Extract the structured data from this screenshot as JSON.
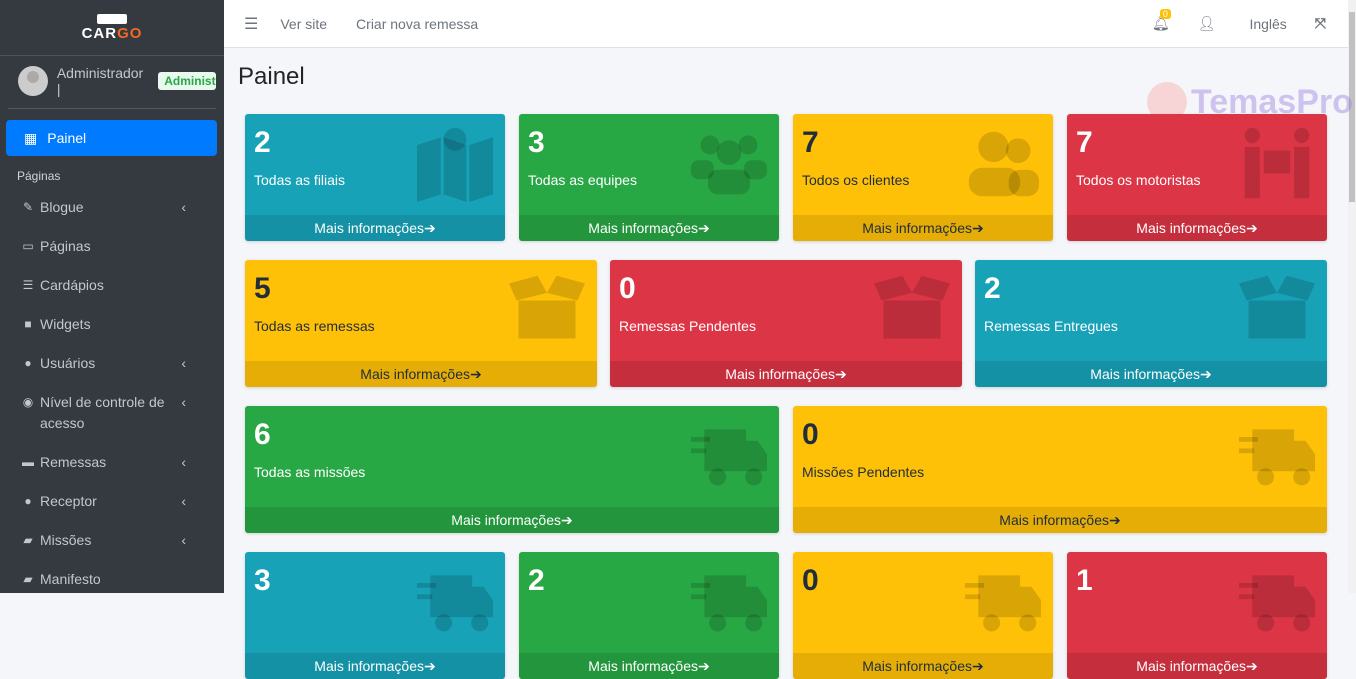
{
  "brand": {
    "name_a": "CAR",
    "name_b": "GO"
  },
  "user": {
    "name": "Administrador |",
    "role": "Administrador"
  },
  "sidebar": {
    "active": "Painel",
    "section": "Páginas",
    "items": [
      {
        "label": "Blogue",
        "icon": "blog-icon",
        "glyph": "✎",
        "chev": true
      },
      {
        "label": "Páginas",
        "icon": "page-icon",
        "glyph": "▭",
        "chev": false
      },
      {
        "label": "Cardápios",
        "icon": "list-icon",
        "glyph": "☰",
        "chev": false
      },
      {
        "label": "Widgets",
        "icon": "widget-icon",
        "glyph": "■",
        "chev": false
      },
      {
        "label": "Usuários",
        "icon": "user-icon",
        "glyph": "●",
        "chev": true
      },
      {
        "label": "Nível de controle de acesso",
        "icon": "accessibility-icon",
        "glyph": "◉",
        "chev": true
      },
      {
        "label": "Remessas",
        "icon": "box-icon",
        "glyph": "▬",
        "chev": true
      },
      {
        "label": "Receptor",
        "icon": "user-icon",
        "glyph": "●",
        "chev": true
      },
      {
        "label": "Missões",
        "icon": "truck-icon",
        "glyph": "▰",
        "chev": true
      },
      {
        "label": "Manifesto",
        "icon": "truck-icon",
        "glyph": "▰",
        "chev": false
      }
    ]
  },
  "topbar": {
    "links": [
      "Ver site",
      "Criar nova remessa"
    ],
    "notifications": "0",
    "language": "Inglês"
  },
  "page": {
    "title": "Painel"
  },
  "watermark": "TemasPro",
  "colors": {
    "info": "#17a2b8",
    "success": "#28a745",
    "warning": "#ffc107",
    "danger": "#dc3545",
    "primary": "#007bff",
    "sidebar": "#343a40"
  },
  "more_label": "Mais informações",
  "cards": [
    {
      "value": "2",
      "label": "Todas as filiais",
      "color": "info",
      "icon": "map-icon"
    },
    {
      "value": "3",
      "label": "Todas as equipes",
      "color": "success",
      "icon": "users-icon"
    },
    {
      "value": "7",
      "label": "Todos os clientes",
      "color": "warning",
      "icon": "user-group-icon"
    },
    {
      "value": "7",
      "label": "Todos os motoristas",
      "color": "danger",
      "icon": "people-carry-icon"
    },
    {
      "value": "5",
      "label": "Todas as remessas",
      "color": "warning",
      "icon": "box-open-icon"
    },
    {
      "value": "0",
      "label": "Remessas Pendentes",
      "color": "danger",
      "icon": "box-open-icon"
    },
    {
      "value": "2",
      "label": "Remessas Entregues",
      "color": "info",
      "icon": "box-open-icon"
    },
    {
      "value": "6",
      "label": "Todas as missões",
      "color": "success",
      "icon": "truck-fast-icon"
    },
    {
      "value": "0",
      "label": "Missões Pendentes",
      "color": "warning",
      "icon": "truck-fast-icon"
    },
    {
      "value": "3",
      "label": "",
      "color": "info",
      "icon": "truck-fast-icon"
    },
    {
      "value": "2",
      "label": "",
      "color": "success",
      "icon": "truck-fast-icon"
    },
    {
      "value": "0",
      "label": "",
      "color": "warning",
      "icon": "truck-fast-icon"
    },
    {
      "value": "1",
      "label": "",
      "color": "danger",
      "icon": "truck-fast-icon"
    }
  ]
}
